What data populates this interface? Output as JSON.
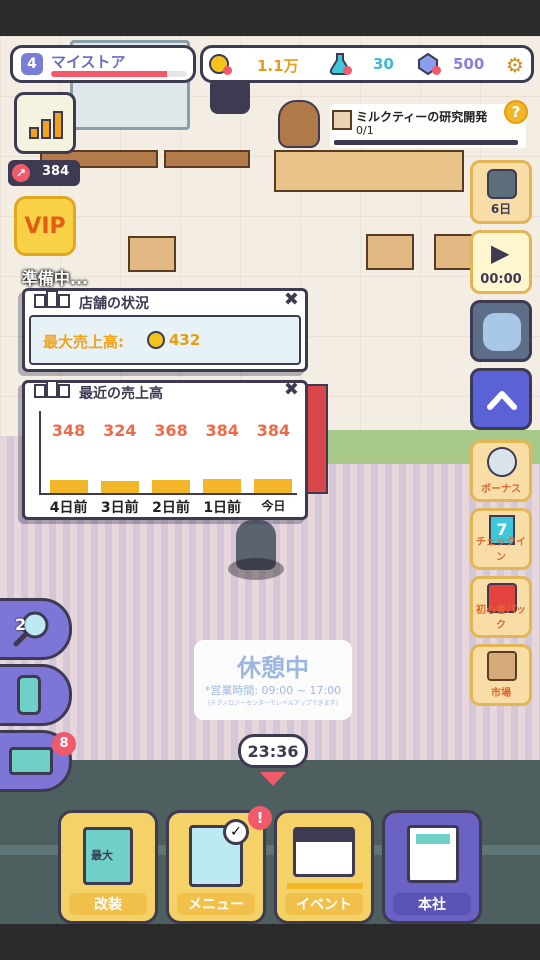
{
  "store": {
    "level": "4",
    "name": "マイストア",
    "xp_fraction": 0.85
  },
  "resources": {
    "coins": "1.1万",
    "potion": "30",
    "gems": "500"
  },
  "research": {
    "title": "ミルクティーの研究開発",
    "progress": "0/1",
    "help": "?"
  },
  "trend": {
    "value": "384"
  },
  "vip": {
    "label": "VIP"
  },
  "status_text": "準備中...",
  "store_status": {
    "title": "店舗の状況",
    "max_sales_label": "最大売上高:",
    "max_sales_value": "432"
  },
  "recent_sales": {
    "title": "最近の売上高"
  },
  "chart_data": {
    "type": "bar",
    "title": "最近の売上高",
    "categories": [
      "4日前",
      "3日前",
      "2日前",
      "1日前",
      "今日"
    ],
    "values": [
      348,
      324,
      368,
      384,
      384
    ],
    "ylim": [
      0,
      432
    ]
  },
  "right_buttons": {
    "days": "6日",
    "timer": "00:00",
    "bonus": "ボーナス",
    "checkin": "チェックイン",
    "checkin_num": "7",
    "beginner_pack": "初心者パック",
    "market": "市場"
  },
  "left_buttons": {
    "search_num": "2",
    "inbox_badge": "8"
  },
  "rest_popup": {
    "title": "休憩中",
    "hours": "*営業時間: 09:00 ~ 17:00",
    "note": "(テクノロジーセンターでレベルアップできます)"
  },
  "clock": "23:36",
  "nav": {
    "renovate": "改装",
    "renovate_tag": "最大",
    "menu": "メニュー",
    "menu_alert": "!",
    "event": "イベント",
    "hq": "本社"
  },
  "colors": {
    "accent": "#7d76d6",
    "dark": "#3d3a52",
    "sales_bar": "#f3b629",
    "sales_text": "#f06a4a"
  },
  "icons": [
    "chart-icon",
    "vip-icon",
    "close-icon",
    "play-icon",
    "up-arrow-icon",
    "magnifier-icon",
    "gear-icon",
    "calendar-icon",
    "register-icon"
  ]
}
